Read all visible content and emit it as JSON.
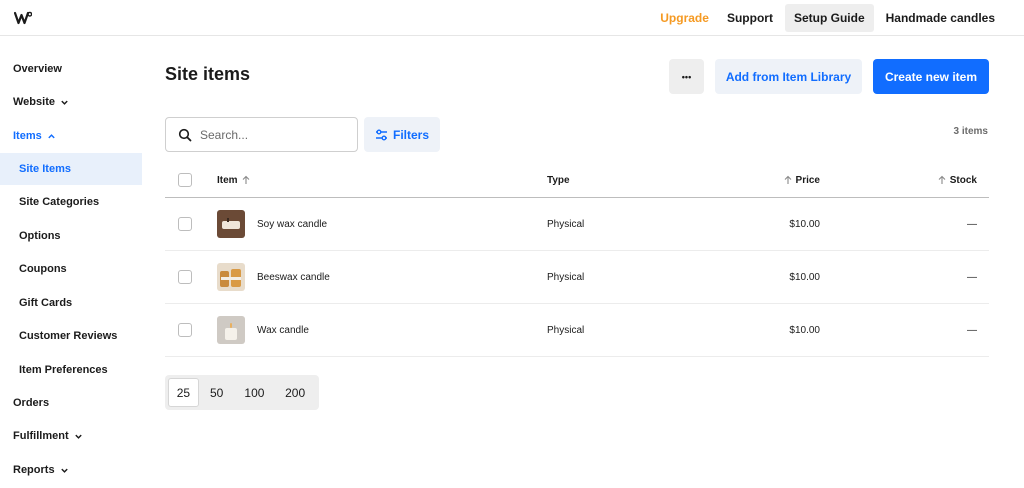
{
  "topbar": {
    "links": [
      "Upgrade",
      "Support",
      "Setup Guide",
      "Handmade candles"
    ]
  },
  "sidebar": {
    "items": [
      {
        "label": "Overview"
      },
      {
        "label": "Website"
      },
      {
        "label": "Items"
      },
      {
        "label": "Site Items"
      },
      {
        "label": "Site Categories"
      },
      {
        "label": "Options"
      },
      {
        "label": "Coupons"
      },
      {
        "label": "Gift Cards"
      },
      {
        "label": "Customer Reviews"
      },
      {
        "label": "Item Preferences"
      },
      {
        "label": "Orders"
      },
      {
        "label": "Fulfillment"
      },
      {
        "label": "Reports"
      }
    ]
  },
  "main": {
    "title": "Site items",
    "more_label": "•••",
    "library_label": "Add from Item Library",
    "create_label": "Create new item",
    "search_placeholder": "Search...",
    "filters_label": "Filters",
    "count": "3 items"
  },
  "table": {
    "headers": {
      "item": "Item",
      "type": "Type",
      "price": "Price",
      "stock": "Stock"
    },
    "rows": [
      {
        "name": "Soy wax candle",
        "type": "Physical",
        "price": "$10.00",
        "stock": "—"
      },
      {
        "name": "Beeswax candle",
        "type": "Physical",
        "price": "$10.00",
        "stock": "—"
      },
      {
        "name": "Wax candle",
        "type": "Physical",
        "price": "$10.00",
        "stock": "—"
      }
    ]
  },
  "pagination": {
    "options": [
      "25",
      "50",
      "100",
      "200"
    ]
  },
  "colors": {
    "accent": "#116dff",
    "upgrade": "#f59a23",
    "selected_bg": "#e8f0fb"
  }
}
